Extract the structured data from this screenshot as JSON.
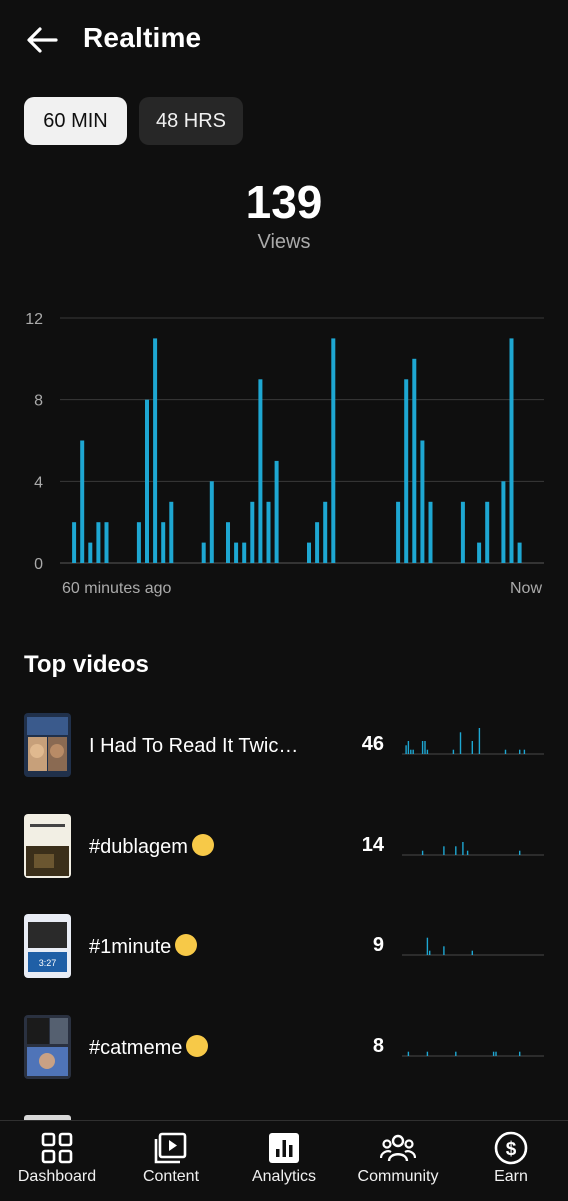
{
  "header": {
    "title": "Realtime"
  },
  "range_chips": [
    {
      "label": "60 MIN",
      "selected": true
    },
    {
      "label": "48 HRS",
      "selected": false
    }
  ],
  "summary": {
    "views": "139",
    "views_label": "Views"
  },
  "chart_data": {
    "type": "bar",
    "title": "",
    "xlabel": "",
    "ylabel": "",
    "x_start_label": "60 minutes ago",
    "x_end_label": "Now",
    "y_ticks": [
      "12",
      "8",
      "4",
      "0"
    ],
    "ylim": [
      0,
      12
    ],
    "grid": true,
    "color": "#1ea7d2",
    "values": [
      0,
      2,
      6,
      1,
      2,
      2,
      0,
      0,
      0,
      2,
      8,
      11,
      2,
      3,
      0,
      0,
      0,
      1,
      4,
      0,
      2,
      1,
      1,
      3,
      9,
      3,
      5,
      0,
      0,
      0,
      1,
      2,
      3,
      11,
      0,
      0,
      0,
      0,
      0,
      0,
      0,
      3,
      9,
      10,
      6,
      3,
      0,
      0,
      0,
      3,
      0,
      1,
      3,
      0,
      4,
      11,
      1,
      0,
      0,
      0
    ]
  },
  "top_videos": {
    "heading": "Top videos",
    "items": [
      {
        "title": "I Had To Read It Twice 🤨",
        "views": "46",
        "spark": [
          0,
          2,
          3,
          1,
          1,
          0,
          0,
          0,
          3,
          3,
          1,
          0,
          0,
          0,
          0,
          0,
          0,
          0,
          0,
          0,
          0,
          1,
          0,
          0,
          5,
          0,
          0,
          0,
          0,
          3,
          0,
          0,
          6,
          0,
          0,
          0,
          0,
          0,
          0,
          0,
          0,
          0,
          0,
          1,
          0,
          0,
          0,
          0,
          0,
          1,
          0,
          1,
          0,
          0,
          0,
          0,
          0,
          0,
          0,
          0
        ],
        "thumb_colors": [
          "#3a5a8c",
          "#e8e8e8"
        ]
      },
      {
        "title": "#dublagem",
        "emoji": "🤨",
        "views": "14",
        "spark": [
          0,
          0,
          0,
          0,
          0,
          0,
          0,
          0,
          1,
          0,
          0,
          0,
          0,
          0,
          0,
          0,
          0,
          2,
          0,
          0,
          0,
          0,
          2,
          0,
          0,
          3,
          0,
          1,
          0,
          0,
          0,
          0,
          0,
          0,
          0,
          0,
          0,
          0,
          0,
          0,
          0,
          0,
          0,
          0,
          0,
          0,
          0,
          0,
          0,
          1,
          0,
          0,
          0,
          0,
          0,
          0,
          0,
          0,
          0,
          0
        ],
        "thumb_colors": [
          "#f2efe4",
          "#6b5630"
        ]
      },
      {
        "title": "#1minute",
        "emoji": "😴",
        "views": "9",
        "spark": [
          0,
          0,
          0,
          0,
          0,
          0,
          0,
          0,
          0,
          0,
          4,
          1,
          0,
          0,
          0,
          0,
          0,
          2,
          0,
          0,
          0,
          0,
          0,
          0,
          0,
          0,
          0,
          0,
          0,
          1,
          0,
          0,
          0,
          0,
          0,
          0,
          0,
          0,
          0,
          0,
          0,
          0,
          0,
          0,
          0,
          0,
          0,
          0,
          0,
          0,
          0,
          0,
          0,
          0,
          0,
          0,
          0,
          0,
          0,
          0
        ],
        "thumb_colors": [
          "#e9edf5",
          "#1f5fa6"
        ]
      },
      {
        "title": "#catmeme",
        "emoji": "🙄",
        "views": "8",
        "spark": [
          0,
          0,
          1,
          0,
          0,
          0,
          0,
          0,
          0,
          0,
          1,
          0,
          0,
          0,
          0,
          0,
          0,
          0,
          0,
          0,
          0,
          0,
          1,
          0,
          0,
          0,
          0,
          0,
          0,
          0,
          0,
          0,
          0,
          0,
          0,
          0,
          0,
          0,
          1,
          1,
          0,
          0,
          0,
          0,
          0,
          0,
          0,
          0,
          0,
          1,
          0,
          0,
          0,
          0,
          0,
          0,
          0,
          0,
          0,
          0
        ],
        "thumb_colors": [
          "#2a3140",
          "#4f74b8"
        ]
      }
    ]
  },
  "bottom_nav": [
    {
      "label": "Dashboard",
      "icon": "dashboard-icon"
    },
    {
      "label": "Content",
      "icon": "content-icon"
    },
    {
      "label": "Analytics",
      "icon": "analytics-icon"
    },
    {
      "label": "Community",
      "icon": "community-icon"
    },
    {
      "label": "Earn",
      "icon": "earn-icon"
    }
  ]
}
